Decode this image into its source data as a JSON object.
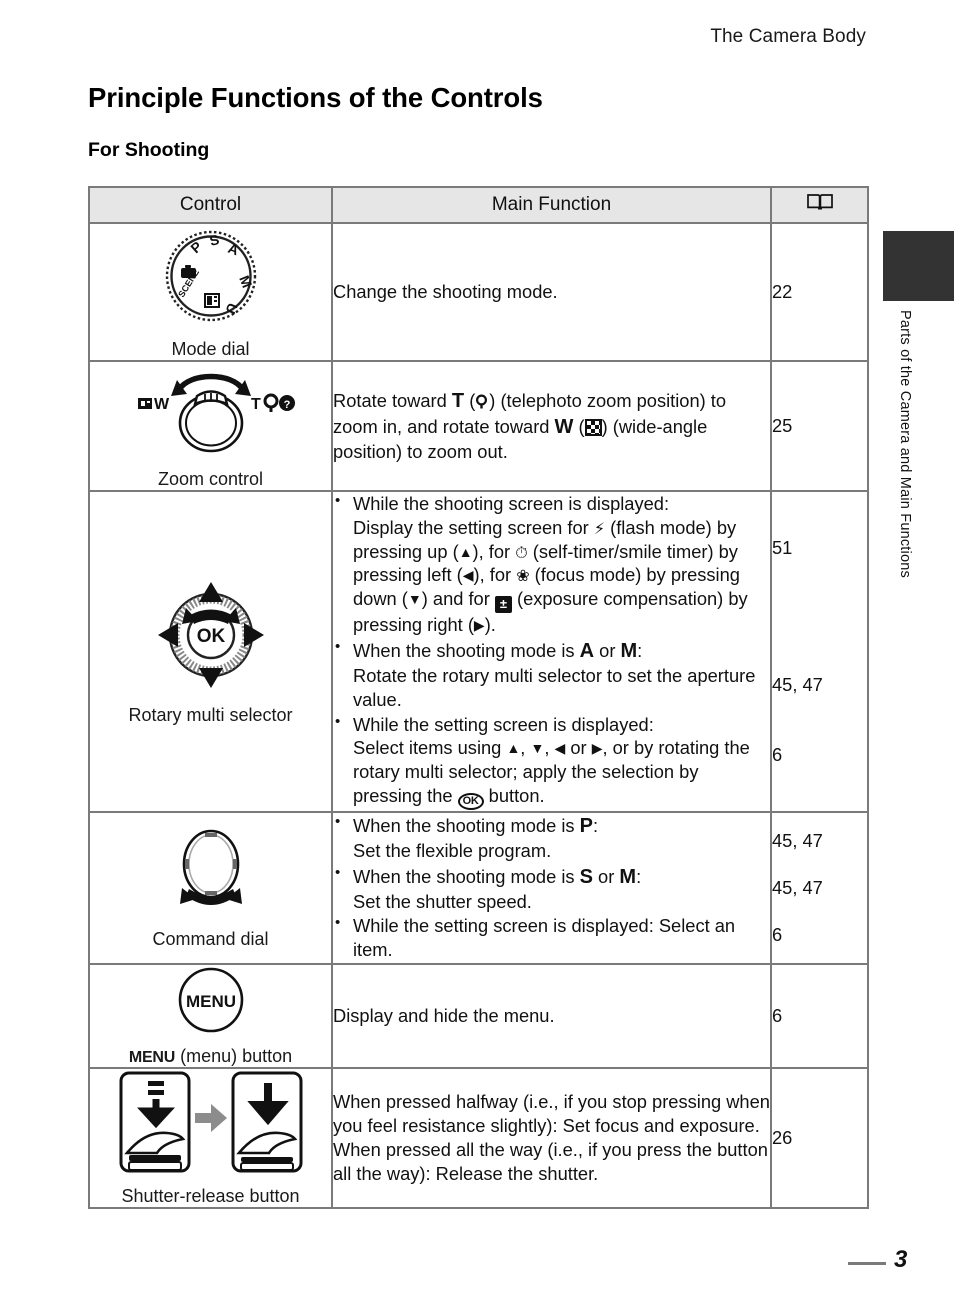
{
  "running_head": "The Camera Body",
  "title": "Principle Functions of the Controls",
  "subtitle": "For Shooting",
  "side_tab_label": "Parts of the Camera and Main Functions",
  "page_number": "3",
  "table": {
    "headers": {
      "control": "Control",
      "main_function": "Main Function",
      "reference": "book-icon"
    },
    "rows": [
      {
        "icon": "mode-dial-icon",
        "control_label": "Mode dial",
        "dial_marks": [
          "P",
          "S",
          "A",
          "M",
          "U",
          "SCENE",
          "camera-auto-icon",
          "effects-icon"
        ],
        "function_text": "Change the shooting mode.",
        "reference": "22"
      },
      {
        "icon": "zoom-control-icon",
        "control_label": "Zoom control",
        "icon_labels": [
          "W",
          "T"
        ],
        "function_text": "Rotate toward T (⌕) (telephoto zoom position) to zoom in, and rotate toward W (▦) (wide-angle position) to zoom out.",
        "function_parts": {
          "p1": "Rotate toward ",
          "t": "T",
          "p2": " (",
          "magnifier": "magnifier-icon",
          "p3": ") (telephoto zoom position) to zoom in, and rotate toward ",
          "w": "W",
          "p4": " (",
          "checker": "thumbnail-icon",
          "p5": ") (wide-angle position) to zoom out."
        },
        "reference": "25"
      },
      {
        "icon": "rotary-multi-selector-icon",
        "control_label": "Rotary multi selector",
        "bullets": [
          {
            "lead": "While the shooting screen is displayed:",
            "body_parts": [
              "Display the setting screen for ",
              "flash-icon",
              " (flash mode) by pressing up (",
              "up-arrow",
              "), for ",
              "self-timer-icon",
              " (self-timer/smile timer) by pressing left (",
              "left-arrow",
              "), for ",
              "macro-icon",
              " (focus mode) by pressing down (",
              "down-arrow",
              ") and for ",
              "exposure-comp-icon",
              " (exposure compensation) by pressing right (",
              "right-arrow",
              ")."
            ],
            "reference": "51"
          },
          {
            "lead_parts": [
              "When the shooting mode is ",
              "A",
              " or ",
              "M",
              ":"
            ],
            "body": "Rotate the rotary multi selector to set the aperture value.",
            "reference": "45, 47"
          },
          {
            "lead": "While the setting screen is displayed:",
            "body_parts": [
              "Select items using ",
              "up-arrow",
              ", ",
              "down-arrow",
              ", ",
              "left-arrow",
              " or ",
              "right-arrow",
              ", or by rotating the rotary multi selector; apply the selection by pressing the ",
              "ok-icon",
              " button."
            ],
            "reference": "6"
          }
        ]
      },
      {
        "icon": "command-dial-icon",
        "control_label": "Command dial",
        "bullets": [
          {
            "lead_parts": [
              "When the shooting mode is ",
              "P",
              ":"
            ],
            "body": "Set the flexible program.",
            "reference": "45, 47"
          },
          {
            "lead_parts": [
              "When the shooting mode is ",
              "S",
              " or ",
              "M",
              ":"
            ],
            "body": "Set the shutter speed.",
            "reference": "45, 47"
          },
          {
            "lead": "While the setting screen is displayed: Select an item.",
            "reference": "6"
          }
        ]
      },
      {
        "icon": "menu-button-icon",
        "icon_text": "MENU",
        "control_label_prefix": "MENU",
        "control_label_suffix": " (menu) button",
        "function_text": "Display and hide the menu.",
        "reference": "6"
      },
      {
        "icon": "shutter-release-button-icon",
        "control_label": "Shutter-release button",
        "function_line_1": "When pressed halfway (i.e., if you stop pressing when you feel resistance slightly): Set focus and exposure.",
        "function_line_2": "When pressed all the way (i.e., if you press the button all the way): Release the shutter.",
        "reference": "26"
      }
    ]
  },
  "colors": {
    "border": "#7a7a7a",
    "header_bg": "#e6e6e6",
    "tab_dark": "#333333",
    "ink": "#111111"
  }
}
